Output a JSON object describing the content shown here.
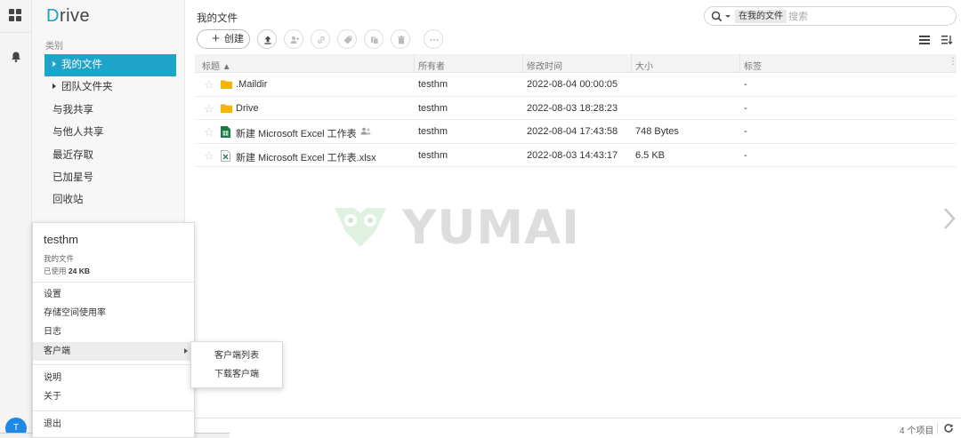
{
  "app": {
    "logo_initial": "D",
    "logo_rest": "rive"
  },
  "nav": {
    "section_label": "类别",
    "items": [
      {
        "label": "我的文件",
        "active": true,
        "expandable": true
      },
      {
        "label": "团队文件夹",
        "active": false,
        "expandable": true
      },
      {
        "label": "与我共享",
        "active": false,
        "expandable": false
      },
      {
        "label": "与他人共享",
        "active": false,
        "expandable": false
      },
      {
        "label": "最近存取",
        "active": false,
        "expandable": false
      },
      {
        "label": "已加星号",
        "active": false,
        "expandable": false
      },
      {
        "label": "回收站",
        "active": false,
        "expandable": false
      }
    ]
  },
  "main": {
    "page_title": "我的文件",
    "create_label": "创建",
    "search": {
      "scope": "在我的文件",
      "placeholder": "搜索"
    }
  },
  "table": {
    "headers": {
      "name": "标题 ▲",
      "owner": "所有者",
      "mtime": "修改时间",
      "size": "大小",
      "tag": "标签"
    },
    "rows": [
      {
        "name": ".Maildir",
        "type": "folder",
        "owner": "testhm",
        "mtime": "2022-08-04 00:00:05",
        "size": "",
        "tag": "-",
        "shared": false
      },
      {
        "name": "Drive",
        "type": "folder",
        "owner": "testhm",
        "mtime": "2022-08-03 18:28:23",
        "size": "",
        "tag": "-",
        "shared": false
      },
      {
        "name": "新建 Microsoft Excel 工作表",
        "type": "sheet",
        "owner": "testhm",
        "mtime": "2022-08-04 17:43:58",
        "size": "748 Bytes",
        "tag": "-",
        "shared": true
      },
      {
        "name": "新建 Microsoft Excel 工作表.xlsx",
        "type": "xlsx",
        "owner": "testhm",
        "mtime": "2022-08-03 14:43:17",
        "size": "6.5 KB",
        "tag": "-",
        "shared": false
      }
    ]
  },
  "footer": {
    "count": "4 个项目"
  },
  "watermark": {
    "text": "YUMAI"
  },
  "user_menu": {
    "username": "testhm",
    "subtitle": "我的文件",
    "usage_label": "已使用",
    "usage_value": "24 KB",
    "items": [
      {
        "label": "设置"
      },
      {
        "label": "存储空间使用率"
      },
      {
        "label": "日志"
      },
      {
        "label": "客户端"
      },
      {
        "label": "说明"
      },
      {
        "label": "关于"
      },
      {
        "label": "退出"
      }
    ],
    "submenu": [
      {
        "label": "客户端列表"
      },
      {
        "label": "下载客户端"
      }
    ]
  },
  "avatar_initial": "T",
  "colors": {
    "accent": "#1fa4c9",
    "avatar": "#1e88e5",
    "excel_green": "#1d7a43",
    "folder_yellow": "#f5b400"
  }
}
